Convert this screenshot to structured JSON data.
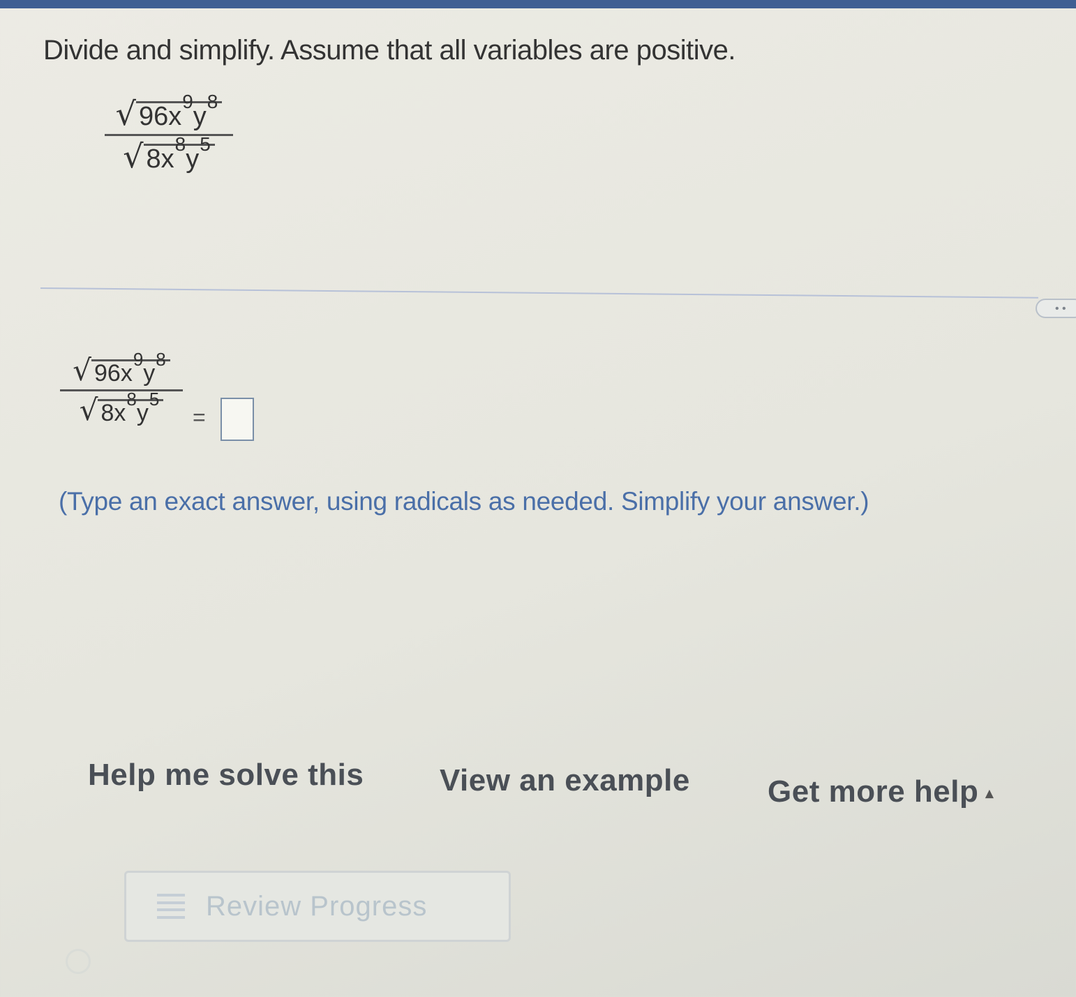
{
  "header": {
    "accent_color": "#3f5f93"
  },
  "question": {
    "instruction": "Divide and simplify. Assume that all variables are positive.",
    "numerator": {
      "coef": "96x",
      "x_exp": "9",
      "y": "y",
      "y_exp": "8"
    },
    "denominator": {
      "coef": "8x",
      "x_exp": "8",
      "y": "y",
      "y_exp": "5"
    }
  },
  "answer": {
    "equals": "=",
    "hint": "(Type an exact answer, using radicals as needed. Simplify your answer.)"
  },
  "more_button": {
    "label": "• •"
  },
  "help": {
    "solve": "Help me solve this",
    "example": "View an example",
    "more": "Get more help",
    "more_caret": "▴"
  },
  "review": {
    "label": "Review Progress",
    "icon": "list-icon"
  }
}
